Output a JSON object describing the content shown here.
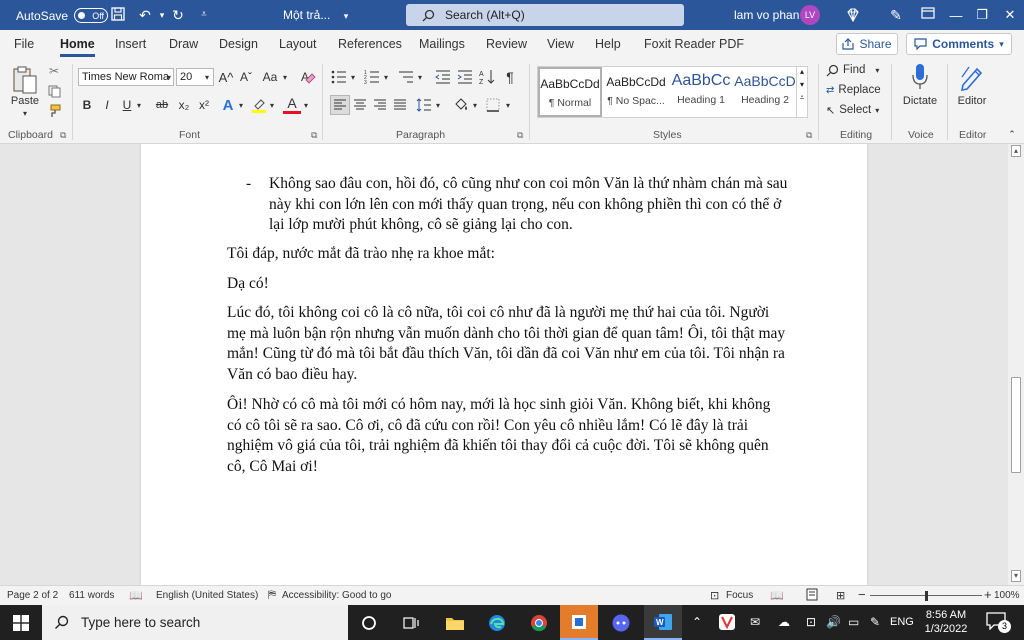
{
  "colors": {
    "word_blue": "#2b579a",
    "font_color_underline": "#e81123",
    "highlight_yellow": "#ffff00",
    "avatar_purple": "#b146c2"
  },
  "titlebar": {
    "autosave_label": "AutoSave",
    "autosave_state": "Off",
    "doc_name": "Một trả...",
    "search_placeholder": "Search (Alt+Q)",
    "user_name": "lam vo phan",
    "user_initials": "LV"
  },
  "tabs": [
    {
      "label": "File"
    },
    {
      "label": "Home",
      "active": true
    },
    {
      "label": "Insert"
    },
    {
      "label": "Draw"
    },
    {
      "label": "Design"
    },
    {
      "label": "Layout"
    },
    {
      "label": "References"
    },
    {
      "label": "Mailings"
    },
    {
      "label": "Review"
    },
    {
      "label": "View"
    },
    {
      "label": "Help"
    },
    {
      "label": "Foxit Reader PDF"
    }
  ],
  "actions": {
    "share": "Share",
    "comments": "Comments"
  },
  "ribbon": {
    "clipboard": {
      "paste": "Paste",
      "label": "Clipboard"
    },
    "font": {
      "family": "Times New Roma",
      "size": "20",
      "label": "Font",
      "bold": "B",
      "italic": "I",
      "underline": "U",
      "strike": "ab",
      "subscript": "x₂",
      "superscript": "x²",
      "grow": "A^",
      "shrink": "Aˇ",
      "case": "Aa",
      "text_effects": "A",
      "font_color": "A"
    },
    "paragraph": {
      "label": "Paragraph",
      "show_marks": "¶"
    },
    "styles": {
      "label": "Styles",
      "items": [
        {
          "sample": "AaBbCcDd",
          "name": "¶ Normal"
        },
        {
          "sample": "AaBbCcDd",
          "name": "¶ No Spac..."
        },
        {
          "sample": "AaBbCc",
          "name": "Heading 1"
        },
        {
          "sample": "AaBbCcD",
          "name": "Heading 2"
        }
      ]
    },
    "editing": {
      "label": "Editing",
      "find": "Find",
      "replace": "Replace",
      "select": "Select"
    },
    "voice": {
      "label": "Voice",
      "dictate": "Dictate"
    },
    "editor": {
      "label": "Editor",
      "editor": "Editor"
    }
  },
  "document": {
    "bullet_mark": "-",
    "bullet_text": "Không sao đâu con, hồi đó, cô cũng như con coi môn Văn là thứ nhàm chán mà sau này khi con lớn lên con mới thấy quan trọng, nếu con không phiền thì con có thể ở lại lớp mười phút không, cô sẽ giảng lại cho con.",
    "paragraphs": [
      "Tôi đáp, nước mắt đã trào nhẹ ra khoe mắt:",
      "Dạ có!",
      "Lúc đó, tôi không coi cô là cô nữa, tôi coi cô như đã là người mẹ thứ hai của tôi. Người mẹ mà luôn bận rộn nhưng vẫn muốn dành cho tôi thời gian để quan tâm! Ôi, tôi thật may mắn! Cũng từ đó mà tôi bắt đầu thích Văn, tôi dần đã coi Văn như em của tôi. Tôi nhận ra Văn có bao điều hay.",
      "Ôi! Nhờ có cô mà tôi mới có hôm nay, mới là học sinh giỏi Văn. Không biết, khi không có cô tôi sẽ ra sao. Cô ơi, cô đã cứu con rồi! Con yêu cô nhiều lắm! Có lẽ đây là trải nghiệm vô giá của tôi, trải nghiệm đã khiến tôi thay đổi cả cuộc đời. Tôi sẽ không quên cô, Cô Mai ơi!"
    ]
  },
  "statusbar": {
    "page": "Page 2 of 2",
    "words": "611 words",
    "language": "English (United States)",
    "accessibility": "Accessibility: Good to go",
    "focus": "Focus",
    "zoom": "100%",
    "zoom_level_percent": 100
  },
  "taskbar": {
    "search_placeholder": "Type here to search",
    "language": "ENG",
    "time": "8:56 AM",
    "date": "1/3/2022",
    "notification_count": "3"
  }
}
